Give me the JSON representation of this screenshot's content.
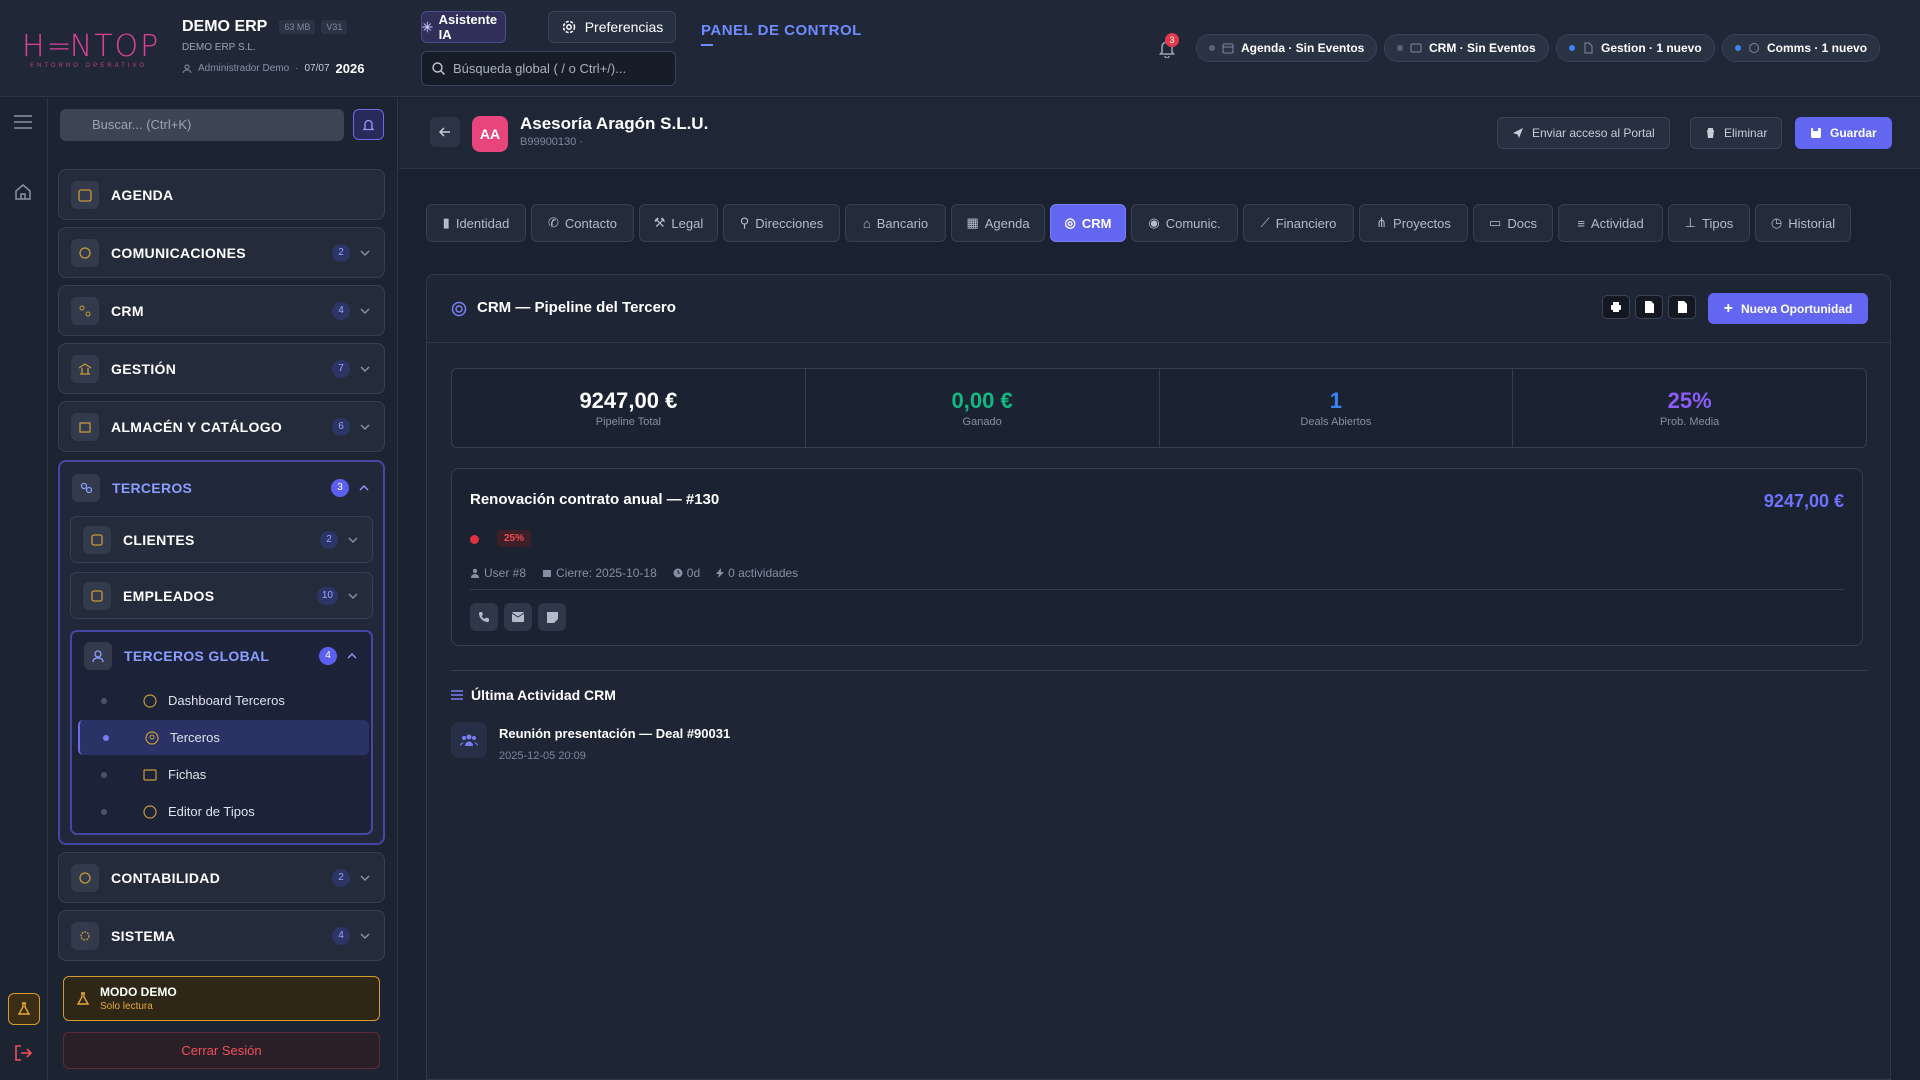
{
  "brand": {
    "logo": "HENTOP",
    "tagline": "ENTORNO OPERATIVO",
    "accent": "#e0409a"
  },
  "company": {
    "name": "DEMO ERP",
    "size": "63 MB",
    "version": "V31",
    "legal_name": "DEMO ERP S.L.",
    "user": "Administrador Demo",
    "date": "07/07",
    "year": "2026"
  },
  "toolbar": {
    "ai_label": "Asistente IA",
    "pref_label": "Preferencias",
    "search_placeholder": "Búsqueda global ( / o Ctrl+/)...",
    "panel_title": "PANEL DE CONTROL",
    "panel_sub": "—",
    "notif_count": "3"
  },
  "status_pills": [
    {
      "label": "Agenda · Sin Eventos",
      "dot": "#5b6477",
      "icon": "calendar-icon"
    },
    {
      "label": "CRM · Sin Eventos",
      "dot": "#5b6477",
      "icon": "crm-icon"
    },
    {
      "label": "Gestion · 1 nuevo",
      "dot": "#3b82f6",
      "icon": "doc-icon"
    },
    {
      "label": "Comms · 1 nuevo",
      "dot": "#3b82f6",
      "icon": "chat-icon"
    }
  ],
  "sidebar": {
    "search_placeholder": "Buscar... (Ctrl+K)",
    "modules": [
      {
        "label": "AGENDA",
        "badge": ""
      },
      {
        "label": "COMUNICACIONES",
        "badge": "2"
      },
      {
        "label": "CRM",
        "badge": "4"
      },
      {
        "label": "GESTIÓN",
        "badge": "7"
      },
      {
        "label": "ALMACÉN Y CATÁLOGO",
        "badge": "6"
      }
    ],
    "terceros": {
      "label": "TERCEROS",
      "badge": "3",
      "subs": [
        {
          "label": "CLIENTES",
          "badge": "2"
        },
        {
          "label": "EMPLEADOS",
          "badge": "10"
        }
      ],
      "global": {
        "label": "TERCEROS GLOBAL",
        "badge": "4",
        "items": [
          "Dashboard Terceros",
          "Terceros",
          "Fichas",
          "Editor de Tipos"
        ],
        "active": "Terceros"
      }
    },
    "modules_bottom": [
      {
        "label": "CONTABILIDAD",
        "badge": "2"
      },
      {
        "label": "SISTEMA",
        "badge": "4"
      }
    ],
    "demo_title": "MODO DEMO",
    "demo_sub": "Solo lectura",
    "logout": "Cerrar Sesión"
  },
  "record": {
    "initials": "AA",
    "name": "Asesoría Aragón S.L.U.",
    "id": "B99900130 ·",
    "btn_portal": "Enviar acceso al Portal",
    "btn_delete": "Eliminar",
    "btn_save": "Guardar"
  },
  "tabs": [
    {
      "label": "Identidad",
      "icon": "id-icon"
    },
    {
      "label": "Contacto",
      "icon": "phone-icon"
    },
    {
      "label": "Legal",
      "icon": "gavel-icon"
    },
    {
      "label": "Direcciones",
      "icon": "pin-icon"
    },
    {
      "label": "Bancario",
      "icon": "bank-icon"
    },
    {
      "label": "Agenda",
      "icon": "calendar-icon"
    },
    {
      "label": "CRM",
      "icon": "target-icon"
    },
    {
      "label": "Comunic.",
      "icon": "chat-icon"
    },
    {
      "label": "Financiero",
      "icon": "chart-icon"
    },
    {
      "label": "Proyectos",
      "icon": "project-icon"
    },
    {
      "label": "Docs",
      "icon": "folder-icon"
    },
    {
      "label": "Actividad",
      "icon": "list-icon"
    },
    {
      "label": "Tipos",
      "icon": "hierarchy-icon"
    },
    {
      "label": "Historial",
      "icon": "history-icon"
    }
  ],
  "active_tab": "CRM",
  "crm": {
    "title": "CRM — Pipeline del Tercero",
    "new_btn": "Nueva Oportunidad",
    "kpis": [
      {
        "value": "9247,00 €",
        "label": "Pipeline Total",
        "color": "#ffffff"
      },
      {
        "value": "0,00 €",
        "label": "Ganado",
        "color": "#10b981"
      },
      {
        "value": "1",
        "label": "Deals Abiertos",
        "color": "#3b82f6"
      },
      {
        "value": "25%",
        "label": "Prob. Media",
        "color": "#8b5cf6"
      }
    ],
    "deal": {
      "title": "Renovación contrato anual — #130",
      "amount": "9247,00 €",
      "probability": "25%",
      "user": "User #8",
      "close": "Cierre: 2025-10-18",
      "age": "0d",
      "activities": "0 actividades"
    },
    "last_title": "Última Actividad CRM",
    "last_activity": {
      "title": "Reunión presentación — Deal #90031",
      "date": "2025-12-05 20:09"
    }
  }
}
